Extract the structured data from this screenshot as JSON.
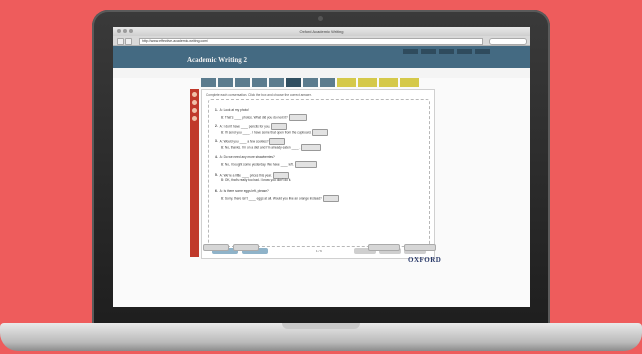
{
  "browser": {
    "window_title": "Oxford Academic Writing",
    "url": "http://www.effective-academic-writing.com/"
  },
  "app": {
    "title": "Academic Writing 2",
    "tabs": [
      "",
      "",
      "",
      "",
      "",
      "",
      "",
      "",
      "",
      "",
      "",
      ""
    ]
  },
  "exercise": {
    "instruction": "Complete each conversation. Click the box and choose the correct answer.",
    "questions": [
      {
        "num": "1.",
        "a": "A: Look at my photo!",
        "b": "B: That's ____ photos. What did you do next it?"
      },
      {
        "num": "2.",
        "a": "A: I don't have ____ pencils for you.",
        "b": "B: I'll send you ____ . I have some that open from the cupboard."
      },
      {
        "num": "3.",
        "a": "A: Would you ____ a few cookies?",
        "b": "B: No, thanks. I'm on a diet and I'm already eaten ____ ."
      },
      {
        "num": "4.",
        "a": "A: Do we need any more strawberries?",
        "b": "B: No, I bought some yesterday. We have ____ left."
      },
      {
        "num": "5.",
        "a": "A: We're a little ____ prices this year.",
        "b": "B: OK, that's really too bad. I know you don't do it."
      },
      {
        "num": "6.",
        "a": "A: Is there some eggs left, please?",
        "b": "B: Sorry, there isn't ____ eggs at all. Would you like an orange instead?"
      }
    ],
    "pager": "1 / 6"
  },
  "brand": "OXFORD"
}
